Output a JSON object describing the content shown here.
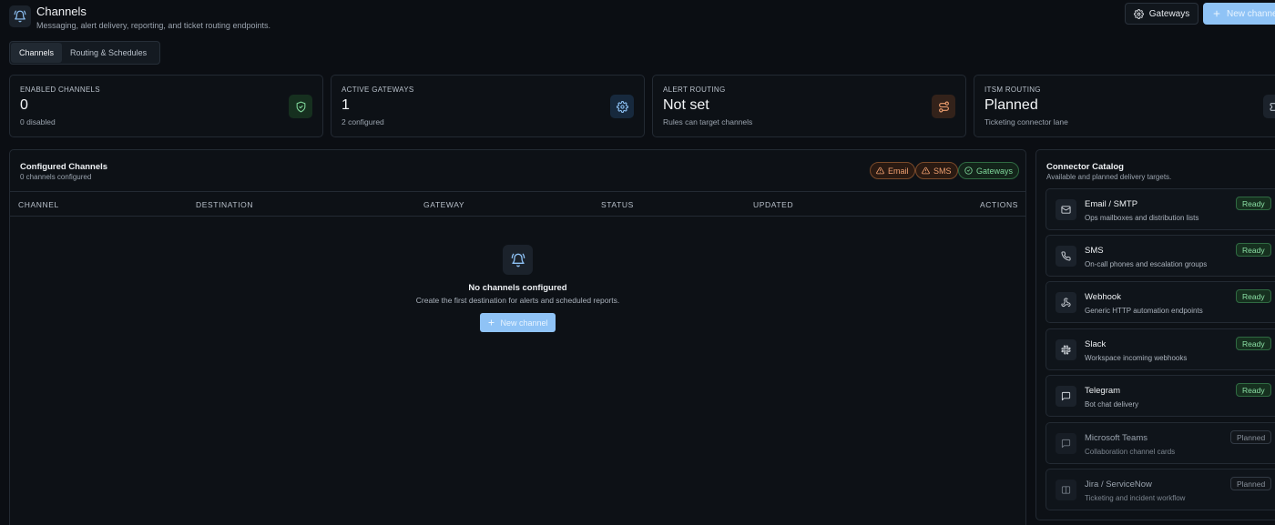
{
  "header": {
    "title": "Channels",
    "subtitle": "Messaging, alert delivery, reporting, and ticket routing endpoints.",
    "gateways_button": "Gateways",
    "new_channel_button": "New channel"
  },
  "tabs": [
    {
      "label": "Channels",
      "active": true
    },
    {
      "label": "Routing & Schedules",
      "active": false
    }
  ],
  "stats": [
    {
      "label": "Enabled Channels",
      "value": "0",
      "sub": "0 disabled",
      "icon": "shield-check-icon",
      "color": "#7fd69a"
    },
    {
      "label": "Active Gateways",
      "value": "1",
      "sub": "2 configured",
      "icon": "gear-icon",
      "color": "#8fc3f6"
    },
    {
      "label": "Alert Routing",
      "value": "Not set",
      "sub": "Rules can target channels",
      "icon": "route-icon",
      "color": "#f0a070"
    },
    {
      "label": "ITSM Routing",
      "value": "Planned",
      "sub": "Ticketing connector lane",
      "icon": "ticket-icon",
      "color": "#b8c0ca"
    }
  ],
  "configured": {
    "title": "Configured Channels",
    "subtitle": "0 channels configured",
    "chips": [
      {
        "label": "Email",
        "status": "warn"
      },
      {
        "label": "SMS",
        "status": "warn"
      },
      {
        "label": "Gateways",
        "status": "ok"
      }
    ],
    "columns": [
      "Channel",
      "Destination",
      "Gateway",
      "Status",
      "Updated",
      "Actions"
    ],
    "empty": {
      "title": "No channels configured",
      "subtitle": "Create the first destination for alerts and scheduled reports.",
      "button": "New channel"
    }
  },
  "catalog": {
    "title": "Connector Catalog",
    "subtitle": "Available and planned delivery targets.",
    "items": [
      {
        "name": "Email / SMTP",
        "desc": "Ops mailboxes and distribution lists",
        "badge": "Ready",
        "icon": "mail-icon"
      },
      {
        "name": "SMS",
        "desc": "On-call phones and escalation groups",
        "badge": "Ready",
        "icon": "phone-icon"
      },
      {
        "name": "Webhook",
        "desc": "Generic HTTP automation endpoints",
        "badge": "Ready",
        "icon": "webhook-icon"
      },
      {
        "name": "Slack",
        "desc": "Workspace incoming webhooks",
        "badge": "Ready",
        "icon": "slack-icon"
      },
      {
        "name": "Telegram",
        "desc": "Bot chat delivery",
        "badge": "Ready",
        "icon": "chat-icon"
      },
      {
        "name": "Microsoft Teams",
        "desc": "Collaboration channel cards",
        "badge": "Planned",
        "icon": "chat-icon"
      },
      {
        "name": "Jira / ServiceNow",
        "desc": "Ticketing and incident workflow",
        "badge": "Planned",
        "icon": "ticket-icon"
      }
    ]
  },
  "colors": {
    "accent": "#8fc3f6",
    "ready": "#8be0a5",
    "warning": "#f0a070",
    "background": "#0b0e13"
  }
}
